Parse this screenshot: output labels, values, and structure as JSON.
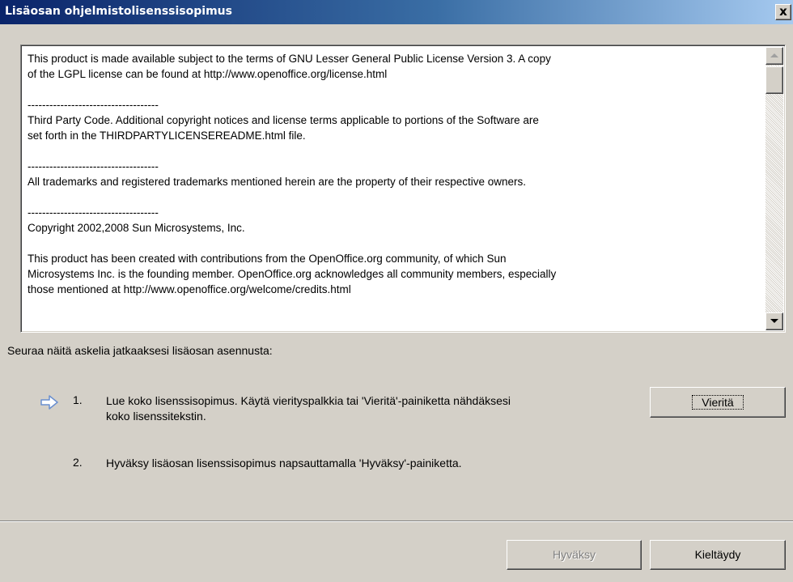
{
  "window": {
    "title": "Lisäosan ohjelmistolisenssisopimus",
    "close_label": "x"
  },
  "license": {
    "text": "This product is made available subject to the terms of GNU Lesser General Public License Version 3. A copy\nof the LGPL license can be found at http://www.openoffice.org/license.html\n\n------------------------------------\nThird Party Code. Additional copyright notices and license terms applicable to portions of the Software are\nset forth in the THIRDPARTYLICENSEREADME.html file.\n\n------------------------------------\nAll trademarks and registered trademarks mentioned herein are the property of their respective owners.\n\n------------------------------------\nCopyright 2002,2008 Sun Microsystems, Inc.\n\nThis product has been created with contributions from the OpenOffice.org community, of which Sun\nMicrosystems Inc. is the founding member. OpenOffice.org acknowledges all community members, especially\nthose mentioned at http://www.openoffice.org/welcome/credits.html"
  },
  "instructions": {
    "heading": "Seuraa näitä askelia jatkaaksesi lisäosan asennusta:",
    "steps": [
      {
        "number": "1.",
        "text": "Lue koko lisenssisopimus. Käytä vierityspalkkia tai 'Vieritä'-painiketta nähdäksesi\nkoko lisenssitekstin."
      },
      {
        "number": "2.",
        "text": "Hyväksy lisäosan lisenssisopimus napsauttamalla 'Hyväksy'-painiketta."
      }
    ]
  },
  "buttons": {
    "scroll": "Vieritä",
    "accept": "Hyväksy",
    "decline": "Kieltäydy"
  },
  "icons": {
    "current_step": "arrow-right-icon"
  },
  "colors": {
    "arrow": "#6a8fcf",
    "title_start": "#0a246a",
    "title_end": "#a6caf0"
  }
}
